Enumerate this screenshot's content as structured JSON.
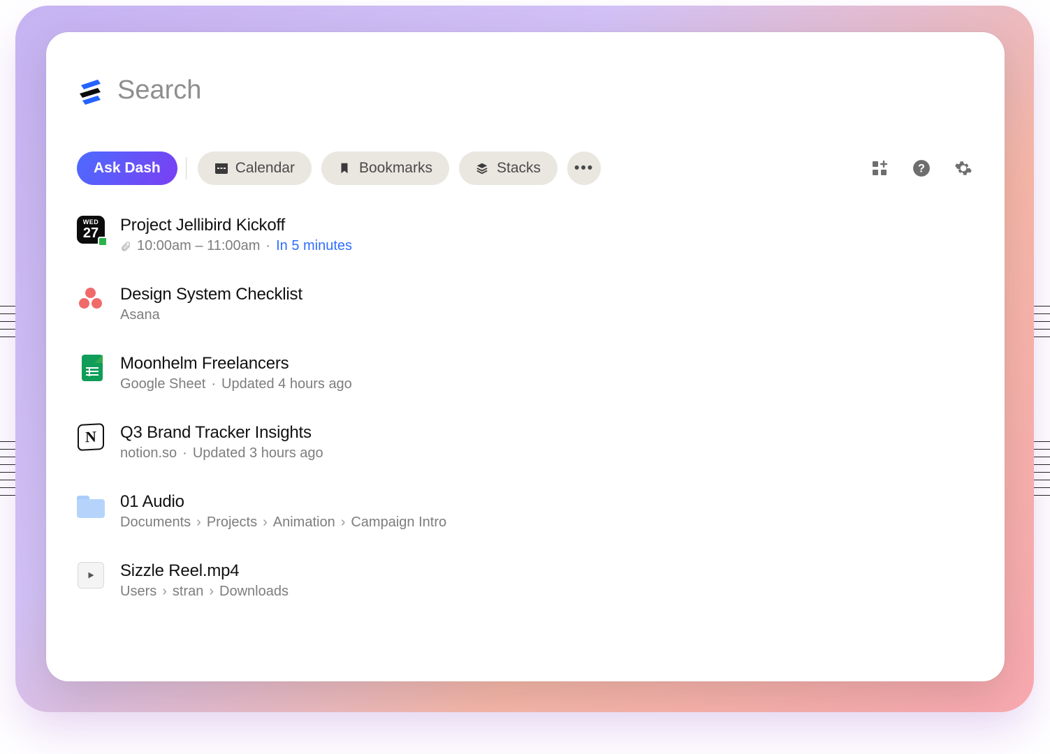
{
  "search": {
    "placeholder": "Search",
    "value": ""
  },
  "chips": {
    "ask": "Ask Dash",
    "calendar": "Calendar",
    "bookmarks": "Bookmarks",
    "stacks": "Stacks",
    "more": "•••"
  },
  "results": [
    {
      "icon": "calendar-date",
      "cal_dow": "WED",
      "cal_dom": "27",
      "title": "Project Jellibird Kickoff",
      "time": "10:00am – 11:00am",
      "rel": "In 5 minutes"
    },
    {
      "icon": "asana",
      "title": "Design System Checklist",
      "source": "Asana"
    },
    {
      "icon": "google-sheet",
      "title": "Moonhelm Freelancers",
      "source": "Google Sheet",
      "updated": "Updated 4 hours ago"
    },
    {
      "icon": "notion",
      "title": "Q3 Brand Tracker Insights",
      "source": "notion.so",
      "updated": "Updated 3 hours ago"
    },
    {
      "icon": "folder",
      "title": "01 Audio",
      "path": [
        "Documents",
        "Projects",
        "Animation",
        "Campaign Intro"
      ]
    },
    {
      "icon": "video",
      "title": "Sizzle Reel.mp4",
      "path": [
        "Users",
        "stran",
        "Downloads"
      ]
    }
  ]
}
